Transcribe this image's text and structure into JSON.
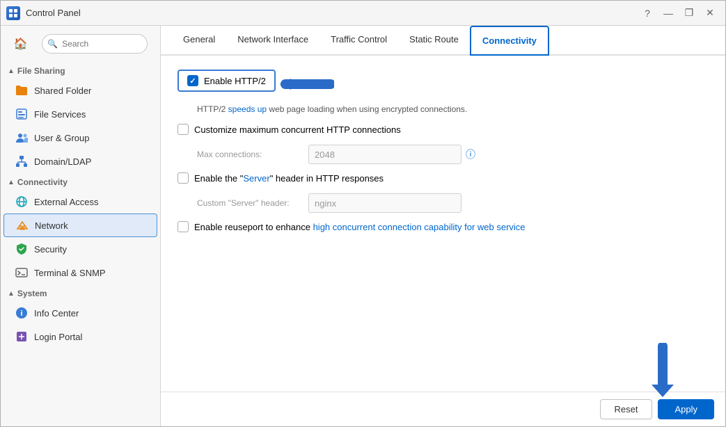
{
  "window": {
    "title": "Control Panel",
    "icon": "control-panel-icon"
  },
  "titlebar": {
    "title": "Control Panel",
    "controls": {
      "help": "?",
      "minimize": "—",
      "maximize": "❐",
      "close": "✕"
    }
  },
  "sidebar": {
    "search_placeholder": "Search",
    "home_icon": "🏠",
    "sections": [
      {
        "name": "file-sharing-section",
        "label": "File Sharing",
        "expanded": true,
        "items": [
          {
            "id": "shared-folder",
            "label": "Shared Folder",
            "icon": "folder-orange"
          },
          {
            "id": "file-services",
            "label": "File Services",
            "icon": "file-blue"
          },
          {
            "id": "user-group",
            "label": "User & Group",
            "icon": "users-blue"
          },
          {
            "id": "domain-ldap",
            "label": "Domain/LDAP",
            "icon": "domain-blue"
          }
        ]
      },
      {
        "name": "connectivity-section",
        "label": "Connectivity",
        "expanded": true,
        "items": [
          {
            "id": "external-access",
            "label": "External Access",
            "icon": "globe-teal"
          },
          {
            "id": "network",
            "label": "Network",
            "icon": "network-house",
            "active": true
          },
          {
            "id": "security",
            "label": "Security",
            "icon": "shield-green"
          },
          {
            "id": "terminal-snmp",
            "label": "Terminal & SNMP",
            "icon": "terminal-gray"
          }
        ]
      },
      {
        "name": "system-section",
        "label": "System",
        "expanded": true,
        "items": [
          {
            "id": "info-center",
            "label": "Info Center",
            "icon": "info-blue"
          },
          {
            "id": "login-portal",
            "label": "Login Portal",
            "icon": "login-purple"
          }
        ]
      }
    ]
  },
  "tabs": [
    {
      "id": "general",
      "label": "General",
      "active": false
    },
    {
      "id": "network-interface",
      "label": "Network Interface",
      "active": false
    },
    {
      "id": "traffic-control",
      "label": "Traffic Control",
      "active": false
    },
    {
      "id": "static-route",
      "label": "Static Route",
      "active": false
    },
    {
      "id": "connectivity",
      "label": "Connectivity",
      "active": true
    }
  ],
  "content": {
    "http2_label": "Enable HTTP/2",
    "http2_checked": true,
    "http2_description": "HTTP/2 speeds up web page loading when using encrypted connections.",
    "http2_description_highlight": "speeds up",
    "customize_http_label": "Customize maximum concurrent HTTP connections",
    "max_connections_label": "Max connections:",
    "max_connections_value": "2048",
    "server_header_label": "Enable the \"Server\" header in HTTP responses",
    "custom_server_label": "Custom \"Server\" header:",
    "custom_server_value": "nginx",
    "reuseport_label": "Enable reuseport to enhance high concurrent connection capability for web service",
    "reuseport_highlight_words": [
      "high",
      "concurrent",
      "connection",
      "capability",
      "for"
    ]
  },
  "footer": {
    "reset_label": "Reset",
    "apply_label": "Apply"
  }
}
